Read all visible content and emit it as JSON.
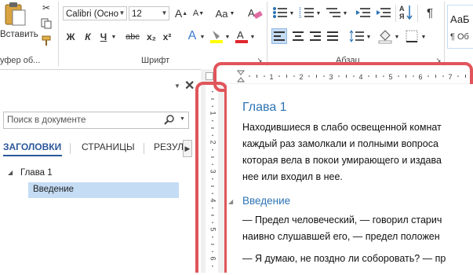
{
  "ribbon": {
    "paste_label": "Вставить",
    "clipboard_group": "уфер об...",
    "font_name": "Calibri (Осно",
    "font_size": "12",
    "font_group": "Шрифт",
    "paragraph_group": "Абзац",
    "bold": "Ж",
    "italic": "К",
    "underline": "Ч",
    "strike": "abc",
    "subscript": "x₂",
    "superscript": "x²",
    "grow": "A",
    "shrink": "A",
    "case": "Aa",
    "style_preview": "АаБ",
    "style_name": "¶ Об",
    "sort": "↓A",
    "pilcrow": "¶"
  },
  "nav": {
    "search_placeholder": "Поиск в документе",
    "tabs": [
      "ЗАГОЛОВКИ",
      "СТРАНИЦЫ",
      "РЕЗУЛ"
    ],
    "tree": [
      {
        "label": "Глава 1"
      },
      {
        "label": "Введение"
      }
    ]
  },
  "ruler": {
    "h_ticks": [
      "1",
      "2",
      "3",
      "4",
      "5",
      "6",
      "7"
    ],
    "v_ticks": [
      "1",
      "2",
      "3",
      "4",
      "5",
      "6"
    ]
  },
  "document": {
    "heading1": "Глава 1",
    "p1": [
      "Находившиеся в слабо освещенной комнат",
      "каждый раз замолкали и полными вопроса",
      "которая вела в покои умирающего и издава",
      "нее или входил в нее."
    ],
    "heading2": "Введение",
    "p2": [
      "— Предел человеческий, — говорил старич",
      "наивно слушавшей его, — предел положен"
    ],
    "p3": "— Я думаю, не поздно ли соборовать? — пр"
  },
  "colors": {
    "accent": "#2e74b5",
    "annotation": "#e0555b",
    "selected": "#c5dcf5"
  }
}
